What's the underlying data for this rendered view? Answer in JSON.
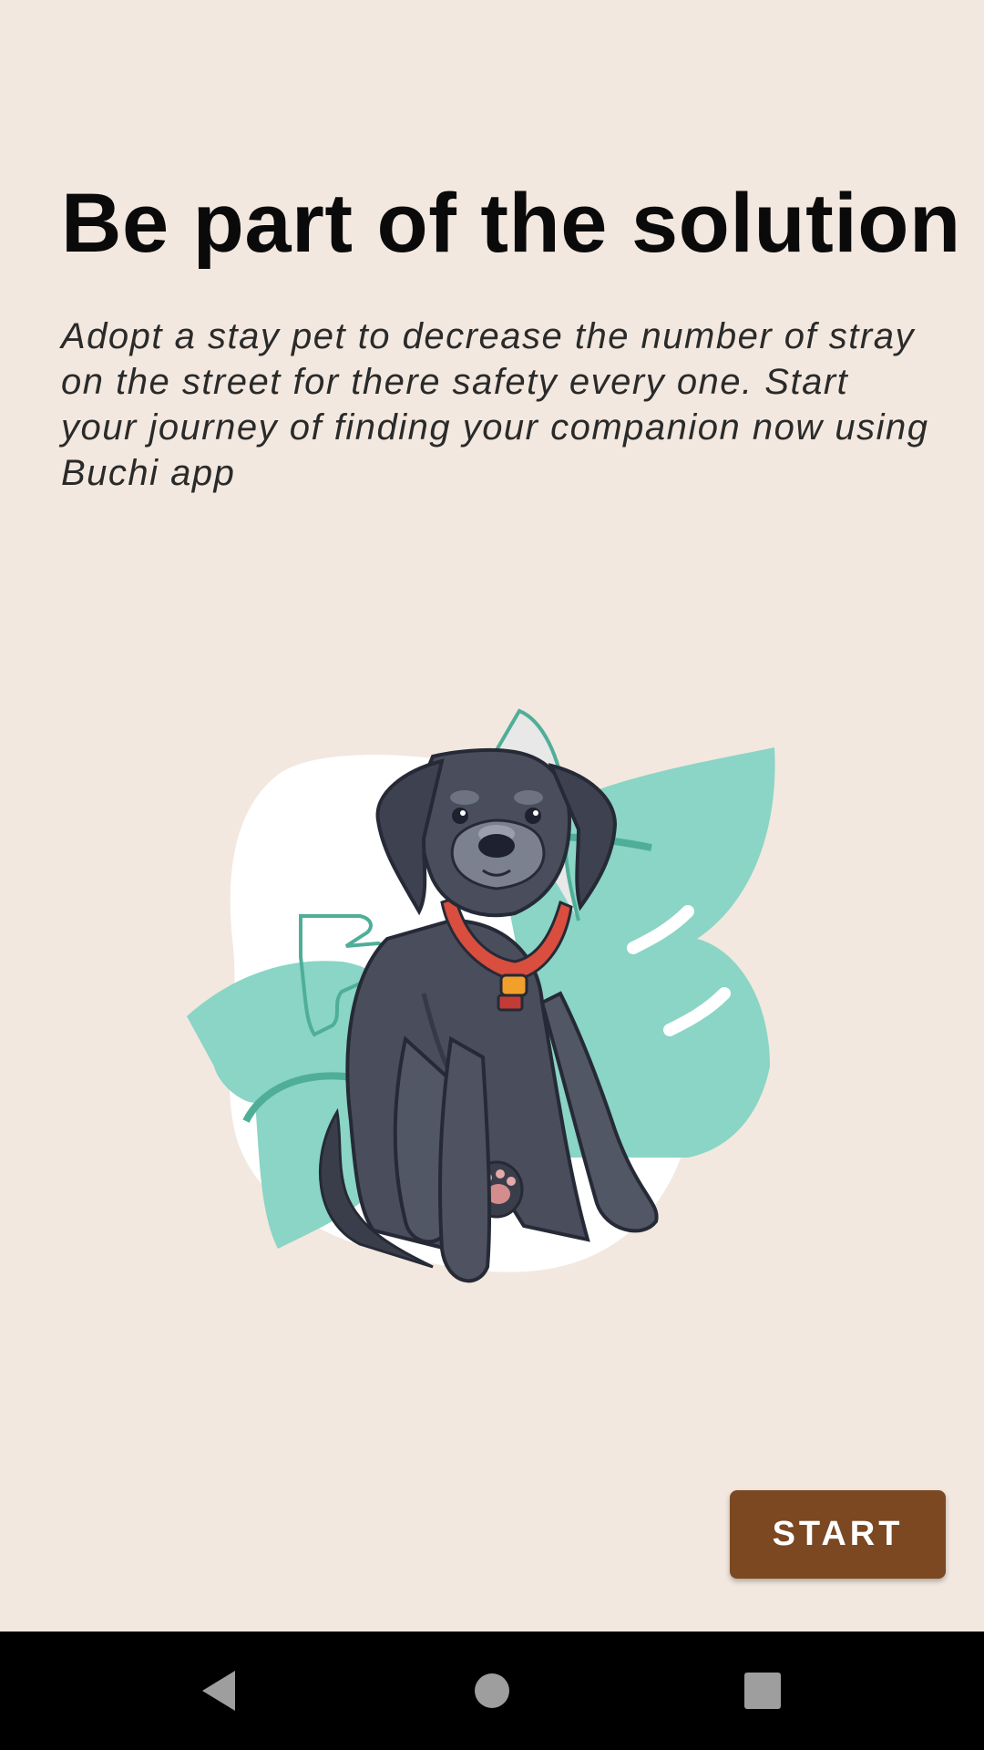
{
  "onboarding": {
    "title": "Be part of the solution",
    "description": "Adopt a stay pet to decrease the number of stray on the street for there safety every one. Start your journey of finding your companion now using Buchi app",
    "illustration_icon": "dog-with-collar-illustration",
    "start_label": "START"
  },
  "navigation": {
    "back_icon": "back-triangle-icon",
    "home_icon": "home-circle-icon",
    "recents_icon": "recents-square-icon"
  },
  "colors": {
    "background": "#f2e8df",
    "button": "#7b4822",
    "button_text": "#ffffff",
    "leaf": "#8ad5c5",
    "leaf_outline": "#4fae98",
    "dog": "#4a4e5c",
    "collar": "#d94e3e",
    "nav_bar": "#000000",
    "nav_icon": "#9e9e9e"
  }
}
